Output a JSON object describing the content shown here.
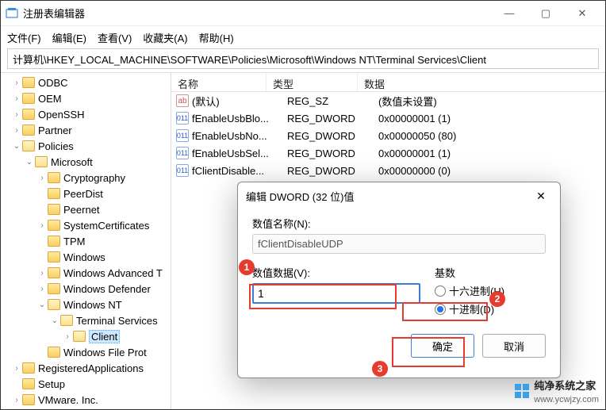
{
  "window": {
    "title": "注册表编辑器",
    "min_icon": "—",
    "max_icon": "▢",
    "close_icon": "✕"
  },
  "menu": {
    "file": "文件(F)",
    "edit": "编辑(E)",
    "view": "查看(V)",
    "favorites": "收藏夹(A)",
    "help": "帮助(H)"
  },
  "path": "计算机\\HKEY_LOCAL_MACHINE\\SOFTWARE\\Policies\\Microsoft\\Windows NT\\Terminal Services\\Client",
  "tree": {
    "items": [
      {
        "indent": 14,
        "toggle": ">",
        "label": "ODBC"
      },
      {
        "indent": 14,
        "toggle": ">",
        "label": "OEM"
      },
      {
        "indent": 14,
        "toggle": ">",
        "label": "OpenSSH"
      },
      {
        "indent": 14,
        "toggle": ">",
        "label": "Partner"
      },
      {
        "indent": 14,
        "toggle": "v",
        "label": "Policies",
        "open": true
      },
      {
        "indent": 30,
        "toggle": "v",
        "label": "Microsoft",
        "open": true
      },
      {
        "indent": 46,
        "toggle": ">",
        "label": "Cryptography"
      },
      {
        "indent": 46,
        "toggle": "",
        "label": "PeerDist"
      },
      {
        "indent": 46,
        "toggle": "",
        "label": "Peernet"
      },
      {
        "indent": 46,
        "toggle": ">",
        "label": "SystemCertificates"
      },
      {
        "indent": 46,
        "toggle": "",
        "label": "TPM"
      },
      {
        "indent": 46,
        "toggle": "",
        "label": "Windows"
      },
      {
        "indent": 46,
        "toggle": ">",
        "label": "Windows Advanced T"
      },
      {
        "indent": 46,
        "toggle": ">",
        "label": "Windows Defender"
      },
      {
        "indent": 46,
        "toggle": "v",
        "label": "Windows NT",
        "open": true
      },
      {
        "indent": 62,
        "toggle": "v",
        "label": "Terminal Services",
        "open": true
      },
      {
        "indent": 78,
        "toggle": ">",
        "label": "Client",
        "open": true,
        "selected": true
      },
      {
        "indent": 46,
        "toggle": "",
        "label": "Windows File Prot"
      },
      {
        "indent": 14,
        "toggle": ">",
        "label": "RegisteredApplications"
      },
      {
        "indent": 14,
        "toggle": "",
        "label": "Setup"
      },
      {
        "indent": 14,
        "toggle": ">",
        "label": "VMware. Inc."
      }
    ]
  },
  "list": {
    "header": {
      "name": "名称",
      "type": "类型",
      "data": "数据"
    },
    "rows": [
      {
        "icon": "ab",
        "name": "(默认)",
        "type": "REG_SZ",
        "data": "(数值未设置)"
      },
      {
        "icon": "bin",
        "name": "fEnableUsbBlo...",
        "type": "REG_DWORD",
        "data": "0x00000001 (1)"
      },
      {
        "icon": "bin",
        "name": "fEnableUsbNo...",
        "type": "REG_DWORD",
        "data": "0x00000050 (80)"
      },
      {
        "icon": "bin",
        "name": "fEnableUsbSel...",
        "type": "REG_DWORD",
        "data": "0x00000001 (1)"
      },
      {
        "icon": "bin",
        "name": "fClientDisable...",
        "type": "REG_DWORD",
        "data": "0x00000000 (0)"
      }
    ]
  },
  "dialog": {
    "title": "编辑 DWORD (32 位)值",
    "close_icon": "✕",
    "name_label": "数值名称(N):",
    "name_value": "fClientDisableUDP",
    "data_label": "数值数据(V):",
    "data_value": "1",
    "base_label": "基数",
    "radio_hex": "十六进制(H)",
    "radio_dec": "十进制(D)",
    "ok": "确定",
    "cancel": "取消"
  },
  "annotations": {
    "n1": "1",
    "n2": "2",
    "n3": "3"
  },
  "watermark": {
    "text": "纯净系统之家",
    "url": "www.ycwjzy.com"
  }
}
